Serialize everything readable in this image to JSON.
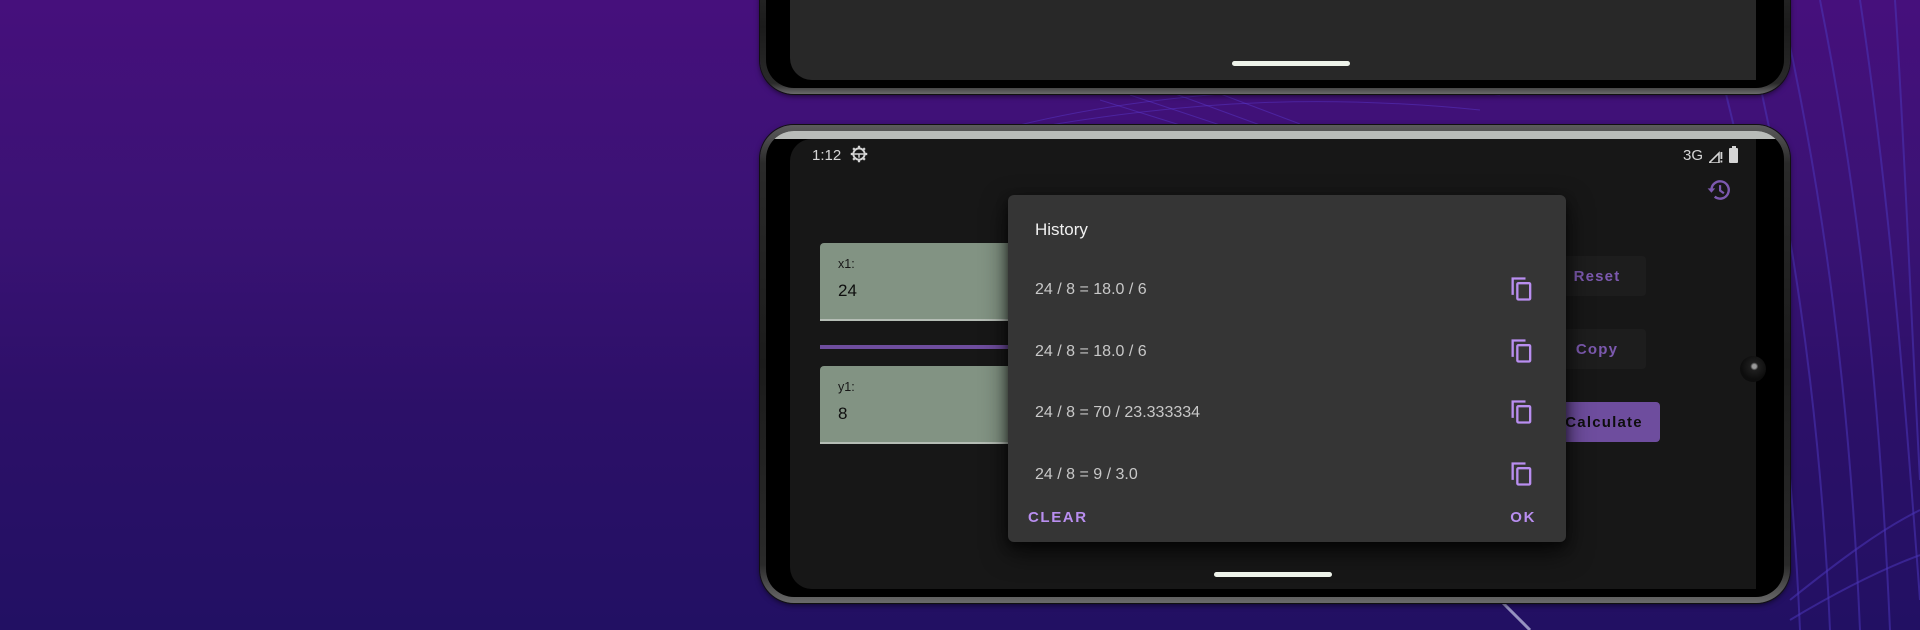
{
  "status_bar": {
    "time": "1:12",
    "network": "3G",
    "icons": [
      "settings-gear-icon",
      "signal-icon",
      "battery-icon"
    ]
  },
  "inputs": {
    "x1": {
      "label": "x1:",
      "value": "24"
    },
    "y1": {
      "label": "y1:",
      "value": "8"
    }
  },
  "buttons": {
    "reset": "Reset",
    "copy": "Copy",
    "calculate": "Calculate"
  },
  "history_dialog": {
    "title": "History",
    "items": [
      {
        "text": "24 / 8 = 18.0 / 6"
      },
      {
        "text": "24 / 8 = 18.0 / 6"
      },
      {
        "text": "24 / 8 = 70 / 23.333334"
      },
      {
        "text": "24 / 8 = 9 / 3.0"
      }
    ],
    "clear_label": "CLEAR",
    "ok_label": "OK"
  },
  "colors": {
    "accent": "#7e58b4",
    "accent_light": "#b98ef0",
    "field_bg": "#95a896",
    "dialog_bg": "#353535",
    "screen_bg": "#1b1b1b"
  }
}
